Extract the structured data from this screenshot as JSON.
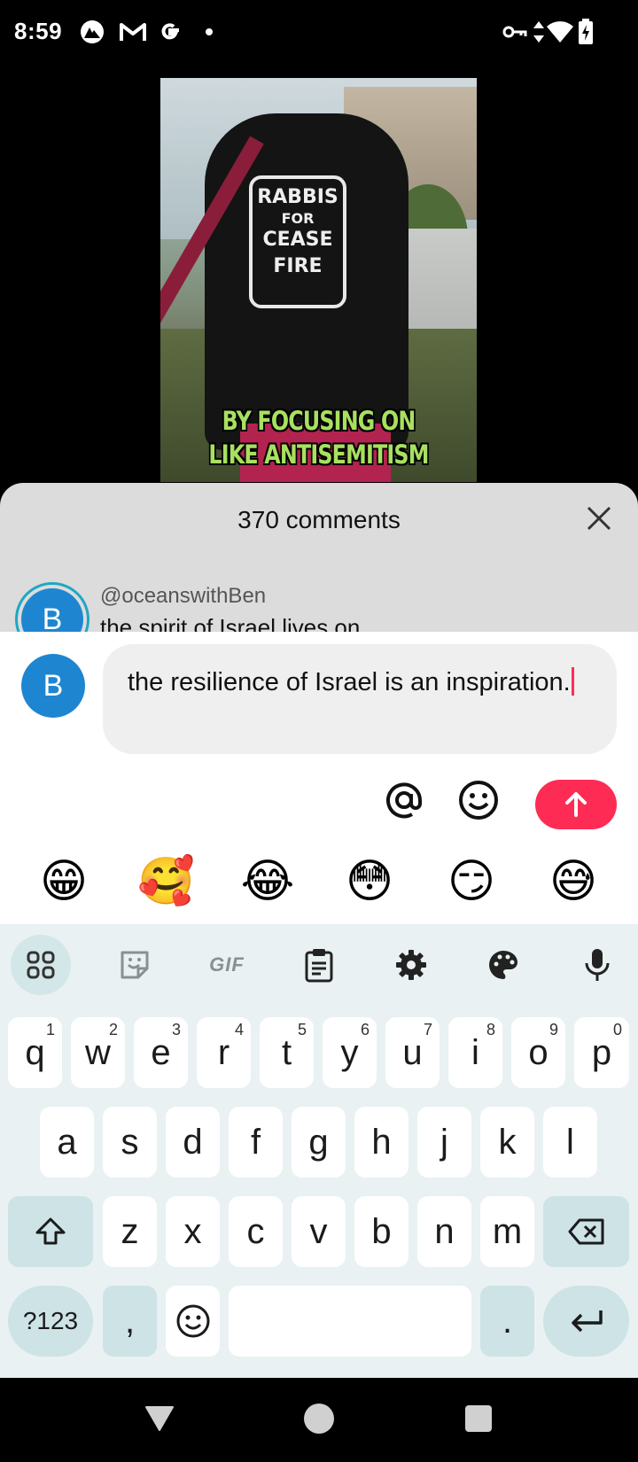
{
  "status_bar": {
    "time": "8:59",
    "left_icons": [
      "nordvpn-icon",
      "gmail-icon",
      "google-icon",
      "notification-dot-icon"
    ],
    "right_icons": [
      "vpn-key-icon",
      "data-arrows-icon",
      "wifi-icon",
      "battery-charging-icon"
    ]
  },
  "video": {
    "caption_line1": "BY FOCUSING ON",
    "caption_line2": "LIKE ANTISEMITISM",
    "shirt_text": [
      "RABBIS",
      "FOR",
      "CEASE",
      "FIRE"
    ]
  },
  "comments": {
    "title": "370 comments",
    "close_icon": "close-icon",
    "first_comment": {
      "avatar_letter": "B",
      "username": "@oceanswithBen",
      "text": "the spirit of Israel lives on"
    }
  },
  "composer": {
    "avatar_letter": "B",
    "input_value": "the resilience of Israel is an inspiration.",
    "icons": [
      "mention-icon",
      "emoji-icon",
      "send-arrow-icon"
    ],
    "accent_color": "#FE2C55",
    "quick_emojis": [
      "😁",
      "🥰",
      "😂",
      "😳",
      "😏",
      "😅"
    ]
  },
  "keyboard": {
    "toolbar": {
      "gif_label": "GIF",
      "icons": [
        "apps-grid-icon",
        "sticker-icon",
        "gif-icon",
        "clipboard-icon",
        "settings-gear-icon",
        "theme-palette-icon",
        "microphone-icon"
      ]
    },
    "row1": [
      {
        "key": "q",
        "hint": "1"
      },
      {
        "key": "w",
        "hint": "2"
      },
      {
        "key": "e",
        "hint": "3"
      },
      {
        "key": "r",
        "hint": "4"
      },
      {
        "key": "t",
        "hint": "5"
      },
      {
        "key": "y",
        "hint": "6"
      },
      {
        "key": "u",
        "hint": "7"
      },
      {
        "key": "i",
        "hint": "8"
      },
      {
        "key": "o",
        "hint": "9"
      },
      {
        "key": "p",
        "hint": "0"
      }
    ],
    "row2": [
      "a",
      "s",
      "d",
      "f",
      "g",
      "h",
      "j",
      "k",
      "l"
    ],
    "row3": [
      "z",
      "x",
      "c",
      "v",
      "b",
      "n",
      "m"
    ],
    "symbols_label": "?123",
    "comma": ",",
    "period": ".",
    "special_icons": [
      "shift-icon",
      "backspace-icon",
      "emoji-key-icon",
      "enter-icon"
    ]
  },
  "nav_bar": {
    "icons": [
      "back-triangle-icon",
      "home-circle-icon",
      "recents-square-icon"
    ]
  }
}
